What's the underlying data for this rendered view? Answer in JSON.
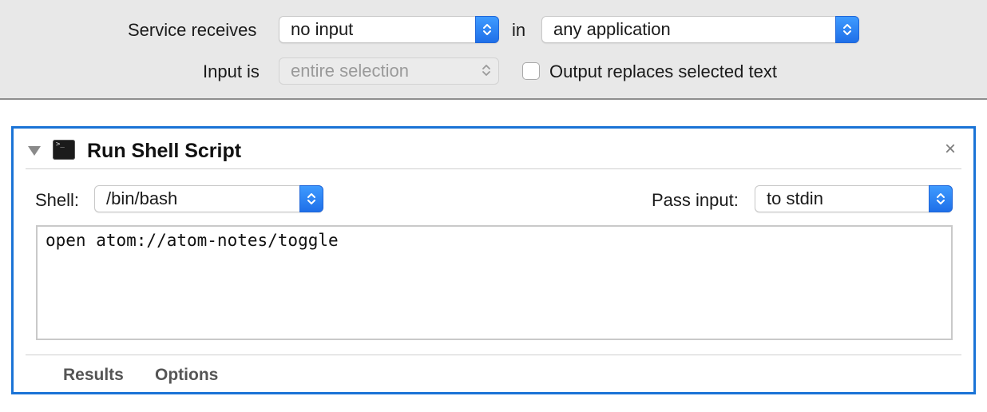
{
  "service": {
    "receives_label": "Service receives",
    "receives_value": "no input",
    "in_label": "in",
    "application_value": "any application",
    "input_is_label": "Input is",
    "input_is_value": "entire selection",
    "output_replaces_label": "Output replaces selected text",
    "output_replaces_checked": false
  },
  "action": {
    "title": "Run Shell Script",
    "shell_label": "Shell:",
    "shell_value": "/bin/bash",
    "pass_input_label": "Pass input:",
    "pass_input_value": "to stdin",
    "script": "open atom://atom-notes/toggle",
    "close_glyph": "×",
    "icon": "terminal-icon",
    "tabs": [
      {
        "label": "Results"
      },
      {
        "label": "Options"
      }
    ]
  },
  "colors": {
    "accent": "#1a73d6",
    "stepper": "#2f86f6",
    "bar_background": "#e8e8e8"
  }
}
